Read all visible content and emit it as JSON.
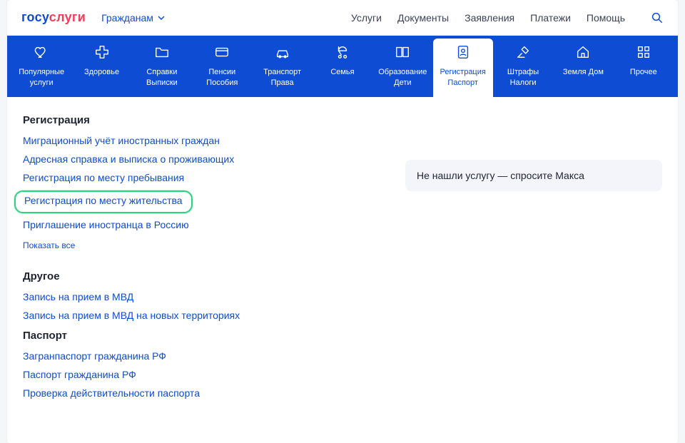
{
  "logo": {
    "p1": "госу",
    "p2": "слуги"
  },
  "audience": {
    "label": "Гражданам"
  },
  "nav": {
    "services": "Услуги",
    "documents": "Документы",
    "requests": "Заявления",
    "payments": "Платежи",
    "help": "Помощь"
  },
  "categories": [
    {
      "key": "popular",
      "labelTop": "Популярные",
      "labelBot": "услуги",
      "icon": "heart"
    },
    {
      "key": "health",
      "labelTop": "Здоровье",
      "labelBot": "",
      "icon": "cross"
    },
    {
      "key": "docs",
      "labelTop": "Справки",
      "labelBot": "Выписки",
      "icon": "folder"
    },
    {
      "key": "pensions",
      "labelTop": "Пенсии",
      "labelBot": "Пособия",
      "icon": "card"
    },
    {
      "key": "transport",
      "labelTop": "Транспорт",
      "labelBot": "Права",
      "icon": "car"
    },
    {
      "key": "family",
      "labelTop": "Семья",
      "labelBot": "",
      "icon": "stroller"
    },
    {
      "key": "education",
      "labelTop": "Образование",
      "labelBot": "Дети",
      "icon": "book"
    },
    {
      "key": "registration",
      "labelTop": "Регистрация",
      "labelBot": "Паспорт",
      "icon": "person-doc",
      "active": true
    },
    {
      "key": "fines",
      "labelTop": "Штрафы",
      "labelBot": "Налоги",
      "icon": "gavel"
    },
    {
      "key": "land",
      "labelTop": "Земля Дом",
      "labelBot": "",
      "icon": "home"
    },
    {
      "key": "other",
      "labelTop": "Прочее",
      "labelBot": "",
      "icon": "grid"
    }
  ],
  "sections": [
    {
      "title": "Регистрация",
      "links": [
        {
          "text": "Миграционный учёт иностранных граждан"
        },
        {
          "text": "Адресная справка и выписка о проживающих"
        },
        {
          "text": "Регистрация по месту пребывания"
        },
        {
          "text": "Регистрация по месту жительства",
          "highlight": true
        },
        {
          "text": "Приглашение иностранца в Россию"
        }
      ],
      "showAll": "Показать все"
    },
    {
      "title": "Другое",
      "links": [
        {
          "text": "Запись на прием в МВД"
        },
        {
          "text": "Запись на прием в МВД на новых территориях"
        }
      ]
    },
    {
      "title": "Паспорт",
      "links": [
        {
          "text": "Загранпаспорт гражданина РФ"
        },
        {
          "text": "Паспорт гражданина РФ"
        },
        {
          "text": "Проверка действительности паспорта"
        }
      ]
    }
  ],
  "rightPanel": {
    "maxPrompt": "Не нашли услугу — спросите Макса"
  }
}
